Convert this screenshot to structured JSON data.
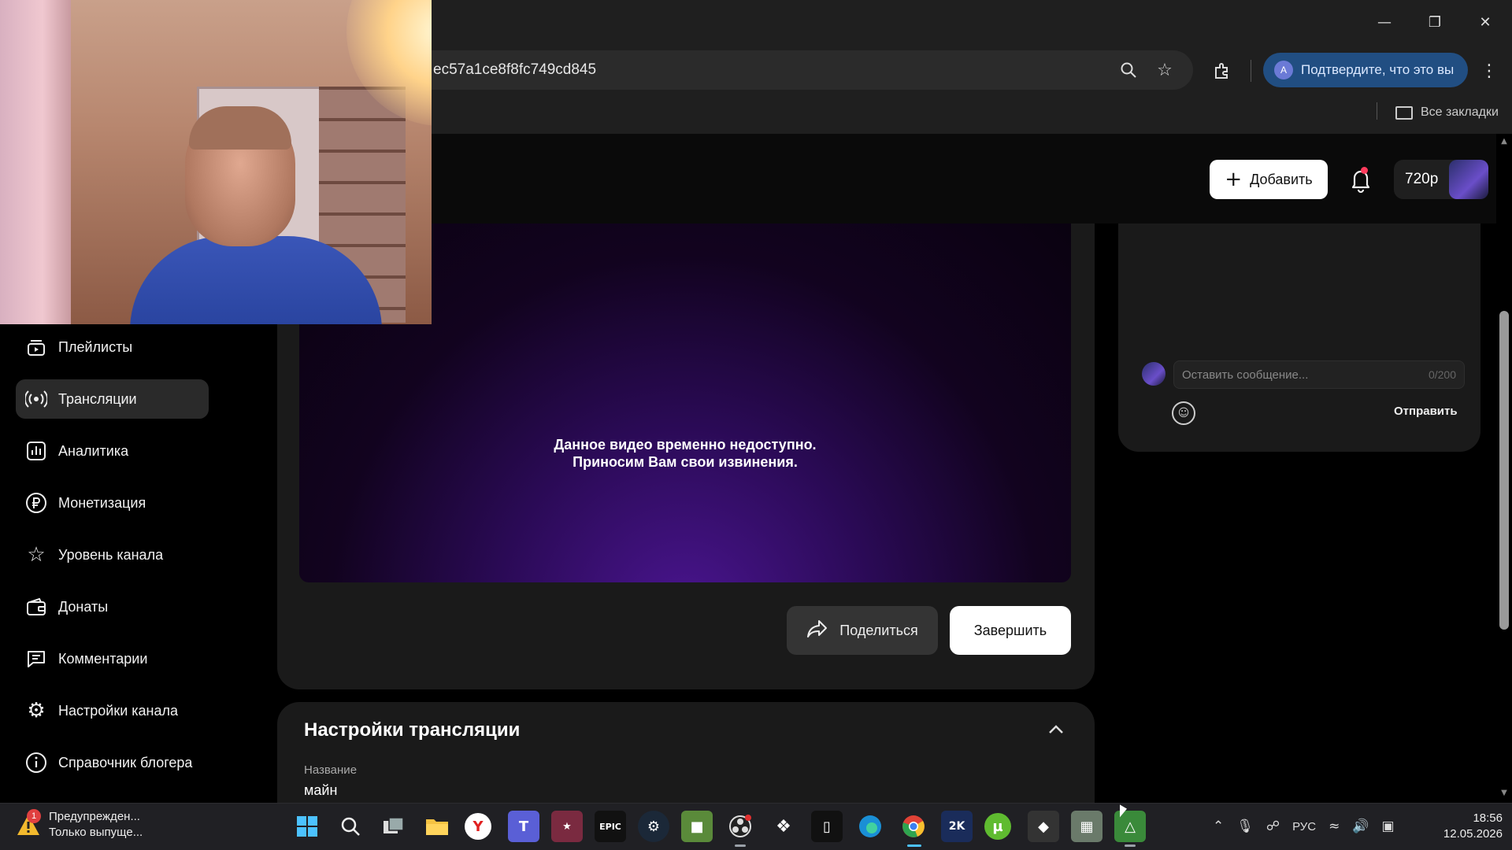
{
  "browser": {
    "url": "ec57a1ce8f8fc749cd845",
    "verify_label": "Подтвердите, что это вы",
    "verify_avatar": "A",
    "all_bookmarks": "Все закладки"
  },
  "header": {
    "add_label": "Добавить",
    "quality_label": "720p"
  },
  "sidebar": {
    "items": [
      {
        "label": "Плейлисты",
        "icon": "playlist-icon"
      },
      {
        "label": "Трансляции",
        "icon": "broadcast-icon",
        "active": true
      },
      {
        "label": "Аналитика",
        "icon": "analytics-icon"
      },
      {
        "label": "Монетизация",
        "icon": "ruble-icon"
      },
      {
        "label": "Уровень канала",
        "icon": "star-icon"
      },
      {
        "label": "Донаты",
        "icon": "wallet-icon"
      },
      {
        "label": "Комментарии",
        "icon": "comment-icon"
      },
      {
        "label": "Настройки канала",
        "icon": "gear-icon"
      },
      {
        "label": "Справочник блогера",
        "icon": "info-icon"
      }
    ]
  },
  "player": {
    "unavailable_line1": "Данное видео временно недоступно.",
    "unavailable_line2": "Приносим Вам свои извинения.",
    "share_label": "Поделиться",
    "finish_label": "Завершить"
  },
  "settings": {
    "title": "Настройки трансляции",
    "name_label": "Название",
    "name_value": "майн"
  },
  "chat": {
    "placeholder": "Оставить сообщение...",
    "counter": "0/200",
    "send_label": "Отправить"
  },
  "taskbar": {
    "notification_title": "Предупрежден...",
    "notification_subtitle": "Только выпуще...",
    "notification_count": "1",
    "language": "РУС",
    "time": "18:56",
    "date": "12.05.2026"
  },
  "colors": {
    "accent_verify": "#214e82",
    "video_purple": "#4a1590",
    "bell_dot": "#ff3b5c"
  }
}
